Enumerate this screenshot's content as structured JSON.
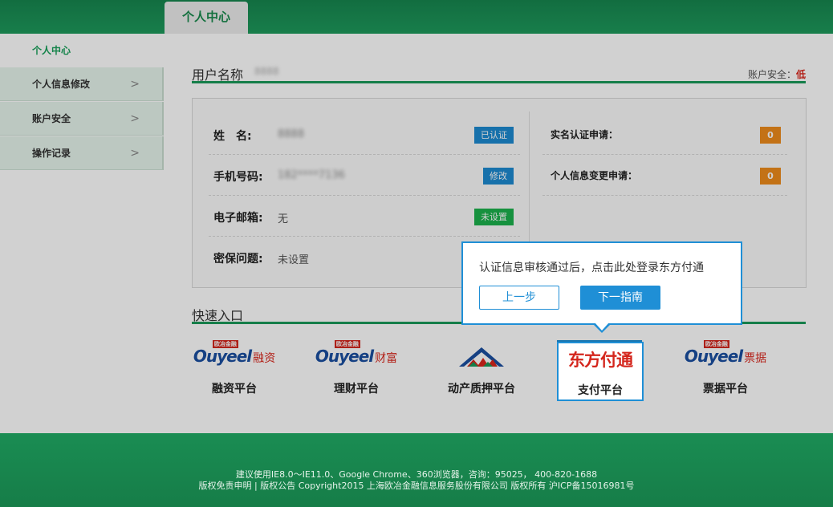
{
  "header": {
    "active_tab": "个人中心"
  },
  "sidebar": {
    "title": "个人中心",
    "items": [
      {
        "label": "个人信息修改",
        "chevron": ">"
      },
      {
        "label": "账户安全",
        "chevron": ">"
      },
      {
        "label": "操作记录",
        "chevron": ">"
      }
    ]
  },
  "user": {
    "heading": "用户名称",
    "name_value": "8888",
    "security_label": "账户安全：",
    "security_level": "低"
  },
  "info": {
    "rows": [
      {
        "label": "姓　名:",
        "value": "8888",
        "button": "已认证"
      },
      {
        "label": "手机号码:",
        "value": "182****7136",
        "button": "修改"
      },
      {
        "label": "电子邮箱:",
        "value": "无",
        "button": "未设置"
      },
      {
        "label": "密保问题:",
        "value": "未设置"
      }
    ],
    "requests": [
      {
        "label": "实名认证申请：",
        "count": "0"
      },
      {
        "label": "个人信息变更申请：",
        "count": "0"
      }
    ]
  },
  "quick": {
    "heading": "快速入口",
    "tiles": [
      {
        "brand": "Ouyeel",
        "tag": "欧冶金融",
        "suffix": "融资",
        "label": "融资平台"
      },
      {
        "brand": "Ouyeel",
        "tag": "欧冶金融",
        "suffix": "财富",
        "label": "理财平台"
      },
      {
        "label": "动产质押平台"
      },
      {
        "brand": "东方付通",
        "label": "支付平台"
      },
      {
        "brand": "Ouyeel",
        "tag": "欧冶金融",
        "suffix": "票据",
        "label": "票据平台"
      }
    ]
  },
  "guide": {
    "message": "认证信息审核通过后，点击此处登录东方付通",
    "prev_label": "上一步",
    "next_label": "下一指南"
  },
  "footer": {
    "line1": "建议使用IE8.0～IE11.0、Google Chrome、360浏览器，咨询：95025， 400-820-1688",
    "line2": "版权免责申明 | 版权公告 Copyright2015 上海欧冶金融信息服务股份有限公司 版权所有 沪ICP备15016981号"
  },
  "colors": {
    "brand_green": "#1a9a5a",
    "accent_blue": "#1f8fd6",
    "badge_orange": "#ee8b1b",
    "danger_red": "#d9261c"
  }
}
